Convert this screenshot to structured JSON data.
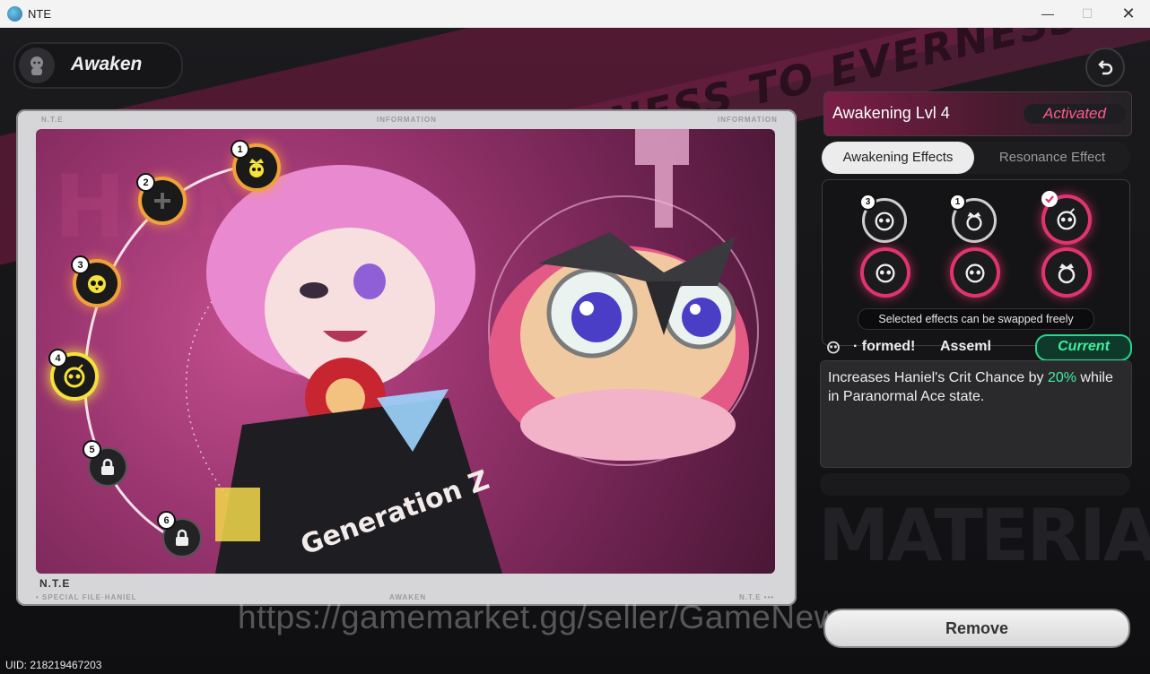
{
  "window": {
    "title": "NTE",
    "minimize": "—",
    "maximize": "☐",
    "close": "✕"
  },
  "header": {
    "title": "Awaken",
    "avatar_icon": "character-silhouette-icon",
    "back_icon": "undo-arrow-icon"
  },
  "card": {
    "brand": "N.T.E",
    "corner_left_top": "N.T.E",
    "corner_center_top": "INFORMATION",
    "corner_right_top": "INFORMATION",
    "bottom_left": "• SPECIAL FILE·HANIEL",
    "bottom_center": "AWAKEN",
    "bottom_right": "N.T.E •••",
    "background_word": "HANIEL",
    "shirt_text": "Generation Z",
    "nodes": [
      {
        "number": "1",
        "state": "activated",
        "icon": "crowned-owl-icon"
      },
      {
        "number": "2",
        "state": "available",
        "icon": "plus-icon"
      },
      {
        "number": "3",
        "state": "activated",
        "icon": "owl-face-icon"
      },
      {
        "number": "4",
        "state": "selected",
        "icon": "bomb-owl-icon"
      },
      {
        "number": "5",
        "state": "locked",
        "icon": "lock-icon"
      },
      {
        "number": "6",
        "state": "locked",
        "icon": "lock-icon"
      }
    ]
  },
  "background": {
    "banner_text": "NEVERNESS TO EVERNESS",
    "materials_text": "MATERIALS"
  },
  "panel": {
    "level_title": "Awakening Lvl 4",
    "level_status": "Activated",
    "tabs": [
      {
        "label": "Awakening Effects",
        "active": true
      },
      {
        "label": "Resonance Effect",
        "active": false
      }
    ],
    "effects_top": [
      {
        "badge": "3",
        "icon": "owl-face-icon",
        "state": "plain"
      },
      {
        "badge": "1",
        "icon": "crowned-owl-icon",
        "state": "plain"
      },
      {
        "badge": "check",
        "icon": "bomb-owl-icon",
        "state": "selected"
      }
    ],
    "effects_bottom": [
      {
        "icon": "bomb-owl-icon",
        "state": "pink"
      },
      {
        "icon": "bomb-owl-icon",
        "state": "pink"
      },
      {
        "icon": "crowned-owl-icon",
        "state": "pink"
      }
    ],
    "tooltip": "Selected effects can be swapped freely",
    "current_name_part1": "· formed!",
    "current_name_part2": "Assembl",
    "current_badge": "Current",
    "description_prefix": "Increases Haniel's Crit Chance by ",
    "description_value": "20%",
    "description_suffix": " while in Paranormal Ace state.",
    "remove_label": "Remove"
  },
  "watermark": "https://gamemarket.gg/seller/GameNews",
  "uid": "UID: 218219467203",
  "colors": {
    "accent_pink": "#e0356c",
    "accent_green": "#3cf09d",
    "node_glow_orange": "#f0a23a",
    "node_glow_yellow": "#f4e23a"
  }
}
